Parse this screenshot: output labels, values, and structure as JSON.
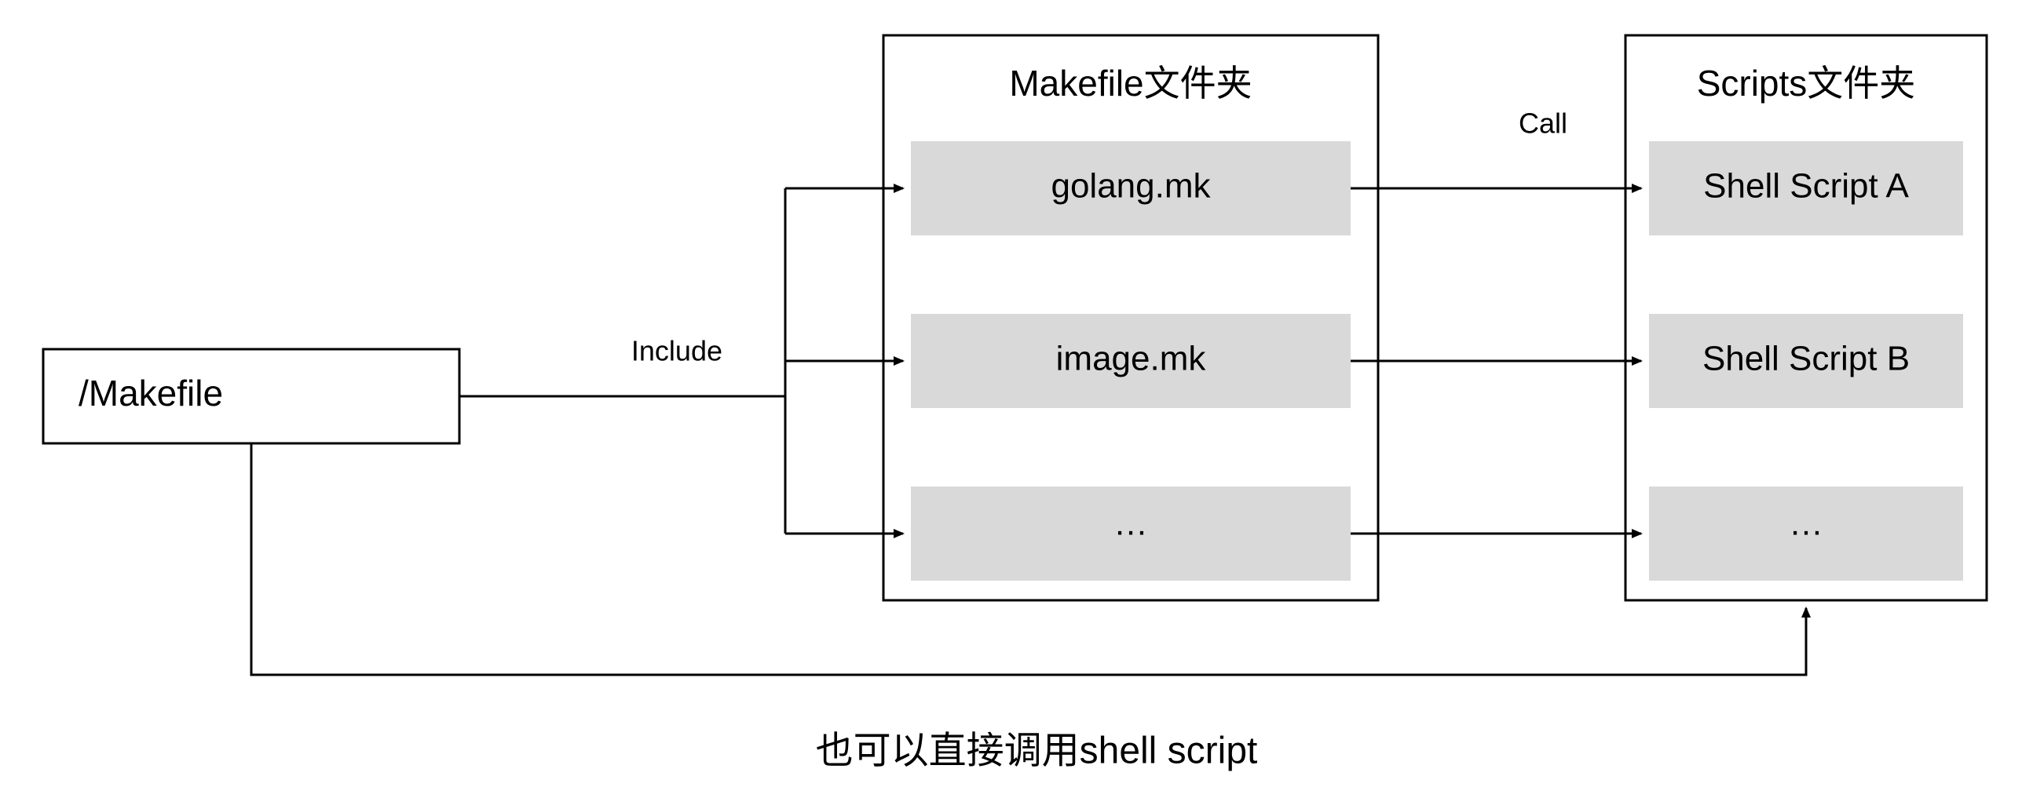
{
  "source": {
    "label": "/Makefile"
  },
  "folders": {
    "makefile": {
      "title": "Makefile文件夹",
      "items": [
        "golang.mk",
        "image.mk",
        "…"
      ]
    },
    "scripts": {
      "title": "Scripts文件夹",
      "items": [
        "Shell Script A",
        "Shell Script B",
        "…"
      ]
    }
  },
  "edges": {
    "include": "Include",
    "call": "Call"
  },
  "caption": "也可以直接调用shell script"
}
